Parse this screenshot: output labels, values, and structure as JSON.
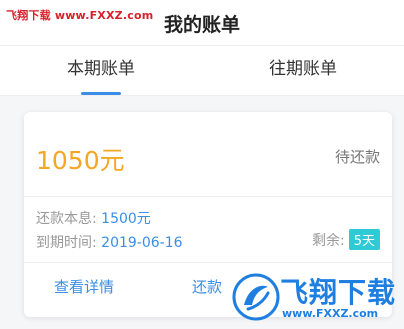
{
  "watermark": {
    "site_text": "飞翔下载 www.FXXZ.com"
  },
  "header": {
    "title": "我的账单"
  },
  "tabs": [
    {
      "label": "本期账单",
      "active": true
    },
    {
      "label": "往期账单",
      "active": false
    }
  ],
  "bill": {
    "amount": "1050元",
    "status": "待还款",
    "principal_label": "还款本息:",
    "principal_value": "1500元",
    "due_label": "到期时间:",
    "due_value": "2019-06-16",
    "remaining_label": "剩余:",
    "remaining_value": "5天",
    "detail_label": "查看详情",
    "repay_label": "还款"
  },
  "logo": {
    "brand_text": "飞翔下载",
    "url_text": "www.FXXZ.com"
  },
  "colors": {
    "amount": "#f5a623",
    "accent": "#3a8ee6",
    "badge": "#2ecbd6",
    "watermark": "#d8202a"
  }
}
